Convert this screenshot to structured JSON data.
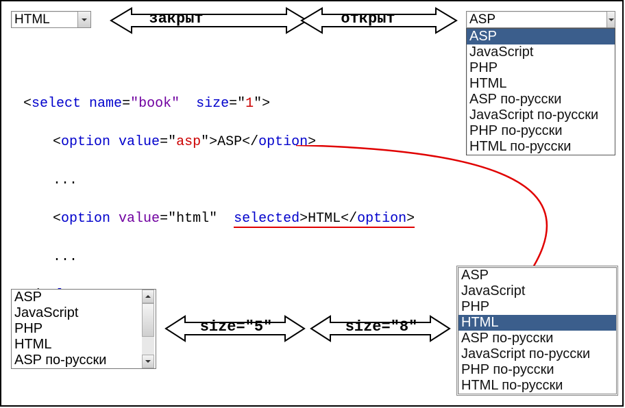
{
  "top": {
    "closed_value": "HTML",
    "label_closed": "закрыт",
    "label_open": "открыт",
    "open_value": "ASP",
    "open_options": [
      "ASP",
      "JavaScript",
      "PHP",
      "HTML",
      "ASP по-русски",
      "JavaScript по-русски",
      "PHP по-русски",
      "HTML по-русски"
    ]
  },
  "code": {
    "l1a": "<",
    "l1b": "select",
    "l1c": " ",
    "l1d": "name",
    "l1e": "=",
    "l1f": "\"book\"",
    "l1g": "  ",
    "l1h": "size",
    "l1i": "=\"",
    "l1j": "1",
    "l1k": "\">",
    "l2a": "<",
    "l2b": "option",
    "l2c": " ",
    "l2d": "value",
    "l2e": "=\"",
    "l2f": "asp",
    "l2g": "\">",
    "l2h": "ASP",
    "l2i": "</",
    "l2j": "option",
    "l2k": ">",
    "dots": "...",
    "l4a": "<",
    "l4b": "option",
    "l4c": " ",
    "l4d": "value",
    "l4e": "=\"html\"",
    "l4f": "  ",
    "l4g": "selected",
    "l4h": ">",
    "l4i": "HTML",
    "l4j": "</",
    "l4k": "option",
    "l4l": ">",
    "l6a": "</",
    "l6b": "select",
    "l6c": ">"
  },
  "bottom": {
    "label5": "size=\"5\"",
    "label8": "size=\"8\"",
    "list5": [
      "ASP",
      "JavaScript",
      "PHP",
      "HTML",
      "ASP по-русски"
    ],
    "list8": [
      "ASP",
      "JavaScript",
      "PHP",
      "HTML",
      "ASP по-русски",
      "JavaScript по-русски",
      "PHP по-русски",
      "HTML по-русски"
    ],
    "list8_selected_index": 3
  }
}
